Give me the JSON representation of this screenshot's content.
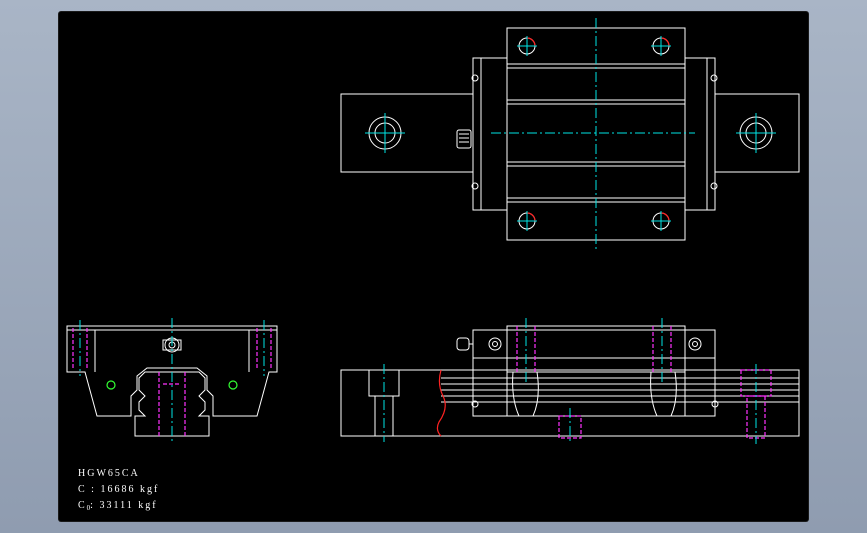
{
  "drawing": {
    "model": "HGW65CA",
    "dynamic_load": {
      "symbol": "C",
      "separator": ":",
      "value": "16686 kgf"
    },
    "static_load": {
      "symbol": "C",
      "subscript": "0",
      "separator": ":",
      "value": "33111 kgf"
    }
  },
  "colors": {
    "background": "#000000",
    "outline": "#ffffff",
    "centerline": "#00e5e5",
    "hidden_line": "#ff33ff",
    "break_line": "#ff2222",
    "lube_point": "#33ff33",
    "window_bg": "#98a5b8"
  },
  "views": [
    "top-view",
    "end-view",
    "side-view"
  ]
}
